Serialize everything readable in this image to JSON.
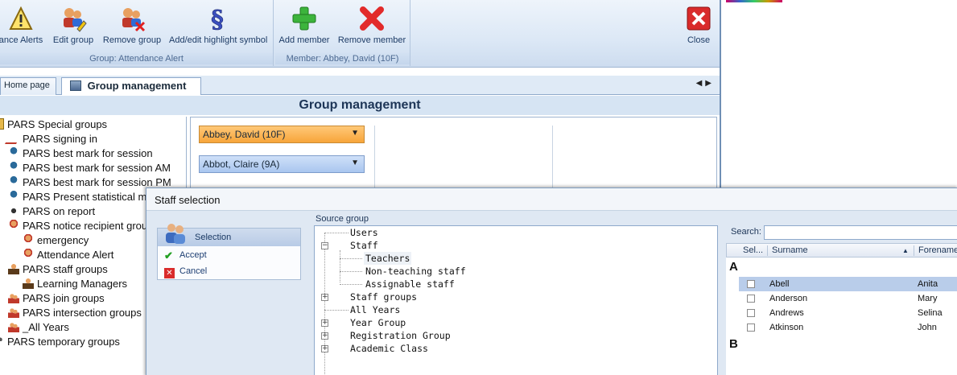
{
  "ribbon": {
    "group_attendance": {
      "title": "Group: Attendance Alert",
      "buttons": [
        {
          "label": "ance Alerts",
          "icon": "warning-icon"
        },
        {
          "label": "Edit group",
          "icon": "edit-group-icon"
        },
        {
          "label": "Remove group",
          "icon": "remove-group-icon"
        },
        {
          "label": "Add/edit highlight symbol",
          "icon": "section-symbol-icon"
        }
      ]
    },
    "group_member": {
      "title": "Member: Abbey, David (10F)",
      "buttons": [
        {
          "label": "Add member",
          "icon": "plus-icon"
        },
        {
          "label": "Remove member",
          "icon": "cross-icon"
        }
      ]
    },
    "close": {
      "label": "Close",
      "icon": "close-icon"
    }
  },
  "tabs": {
    "home": "Home page",
    "active": "Group management"
  },
  "panel_title": "Group management",
  "tree": [
    {
      "label": "PARS Special groups",
      "icon": "folder-icon",
      "level": 0
    },
    {
      "label": "PARS signing in",
      "icon": "signing-icon",
      "level": 1
    },
    {
      "label": "PARS best mark for session",
      "icon": "pin-icon",
      "level": 1
    },
    {
      "label": "PARS best mark for session AM",
      "icon": "pin-icon",
      "level": 1
    },
    {
      "label": "PARS best mark for session PM",
      "icon": "pin-icon",
      "level": 1
    },
    {
      "label": "PARS Present statistical m",
      "icon": "pin-icon",
      "level": 1
    },
    {
      "label": "PARS on report",
      "icon": "report-icon",
      "level": 1
    },
    {
      "label": "PARS notice recipient grou",
      "icon": "recipient-icon",
      "level": 1
    },
    {
      "label": "emergency",
      "icon": "recipient-icon",
      "level": 2
    },
    {
      "label": "Attendance Alert",
      "icon": "recipient-icon",
      "level": 2
    },
    {
      "label": "PARS staff groups",
      "icon": "staff-icon",
      "level": 1
    },
    {
      "label": "Learning Managers",
      "icon": "staff-icon",
      "level": 2
    },
    {
      "label": "PARS join groups",
      "icon": "users-icon",
      "level": 1
    },
    {
      "label": "PARS intersection groups",
      "icon": "users-icon",
      "level": 1
    },
    {
      "label": "_All Years",
      "icon": "users-icon",
      "level": 1
    },
    {
      "label": "PARS temporary groups",
      "icon": "users-icon",
      "level": 0
    }
  ],
  "members": [
    {
      "label": "Abbey, David (10F)"
    },
    {
      "label": "Abbot, Claire (9A)"
    }
  ],
  "dialog": {
    "title": "Staff selection",
    "selection": {
      "header": "Selection",
      "accept": "Accept",
      "cancel": "Cancel"
    },
    "source_group_label": "Source group",
    "source_tree": [
      {
        "label": "Users",
        "level": 1,
        "expander": "none"
      },
      {
        "label": "Staff",
        "level": 1,
        "expander": "minus"
      },
      {
        "label": "Teachers",
        "level": 2,
        "expander": "none",
        "highlighted": true
      },
      {
        "label": "Non-teaching staff",
        "level": 2,
        "expander": "none"
      },
      {
        "label": "Assignable staff",
        "level": 2,
        "expander": "none"
      },
      {
        "label": "Staff groups",
        "level": 1,
        "expander": "plus"
      },
      {
        "label": "All Years",
        "level": 1,
        "expander": "none"
      },
      {
        "label": "Year Group",
        "level": 1,
        "expander": "plus"
      },
      {
        "label": "Registration Group",
        "level": 1,
        "expander": "plus"
      },
      {
        "label": "Academic Class",
        "level": 1,
        "expander": "plus"
      }
    ],
    "search_label": "Search:",
    "search_value": "",
    "grid": {
      "columns": [
        "Sel...",
        "Surname",
        "Forename"
      ],
      "groups": [
        {
          "letter": "A",
          "rows": [
            {
              "surname": "Abell",
              "forename": "Anita",
              "selected": true
            },
            {
              "surname": "Anderson",
              "forename": "Mary",
              "selected": false
            },
            {
              "surname": "Andrews",
              "forename": "Selina",
              "selected": false
            },
            {
              "surname": "Atkinson",
              "forename": "John",
              "selected": false
            }
          ]
        },
        {
          "letter": "B",
          "rows": []
        }
      ]
    }
  }
}
